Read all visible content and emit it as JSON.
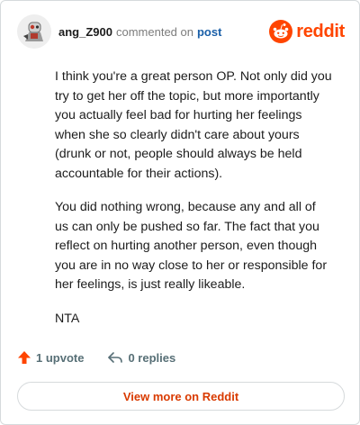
{
  "header": {
    "username": "ang_Z900",
    "commented_on": "commented on",
    "post_link": "post",
    "brand": "reddit"
  },
  "comment": {
    "paragraphs": [
      "I think you're a great person OP. Not only did you try to get her off the topic, but more importantly you actually feel bad for hurting her feelings when she so clearly didn't care about yours (drunk or not, people should always be held accountable for their actions).",
      "You did nothing wrong, because any and all of us can only be pushed so far. The fact that you reflect on hurting another person, even though you are in no way close to her or responsible for her feelings, is just really likeable.",
      "NTA"
    ]
  },
  "actions": {
    "upvotes": "1 upvote",
    "replies": "0 replies"
  },
  "footer": {
    "view_more": "View more on Reddit"
  },
  "colors": {
    "brand": "#ff4500",
    "upvote": "#ff4500",
    "link": "#1a5fa8",
    "view_more": "#d93a00"
  },
  "icons": {
    "avatar": "user-avatar-robot",
    "brand": "reddit-snoo-icon",
    "upvote": "upvote-arrow-icon",
    "reply": "reply-arrow-icon"
  }
}
